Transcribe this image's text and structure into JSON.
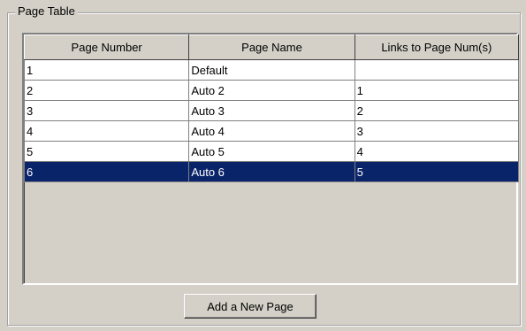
{
  "group": {
    "label": "Page Table"
  },
  "table": {
    "headers": [
      "Page Number",
      "Page Name",
      "Links to Page Num(s)"
    ],
    "rows": [
      {
        "number": "1",
        "name": "Default",
        "links": ""
      },
      {
        "number": "2",
        "name": "Auto 2",
        "links": "1"
      },
      {
        "number": "3",
        "name": "Auto 3",
        "links": "2"
      },
      {
        "number": "4",
        "name": "Auto 4",
        "links": "3"
      },
      {
        "number": "5",
        "name": "Auto 5",
        "links": "4"
      },
      {
        "number": "6",
        "name": "Auto 6",
        "links": "5"
      }
    ],
    "selected_row": "6"
  },
  "buttons": {
    "add_page": "Add a New Page"
  },
  "colors": {
    "selection": "#0a246a",
    "face": "#d4d0c8"
  }
}
